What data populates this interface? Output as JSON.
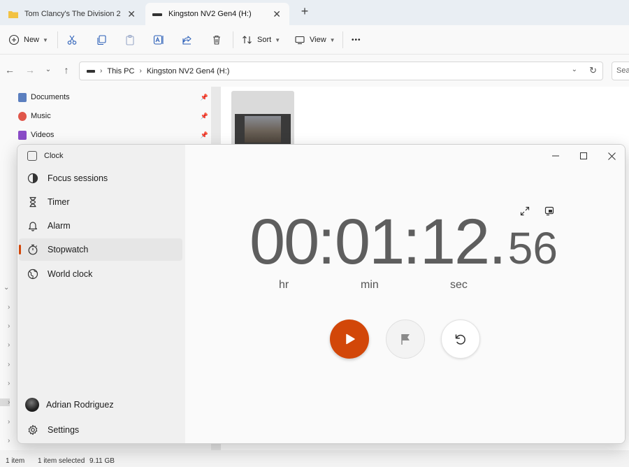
{
  "explorer": {
    "tabs": [
      {
        "label": "Tom Clancy's The Division 2",
        "close": "✕"
      },
      {
        "label": "Kingston NV2 Gen4 (H:)",
        "close": "✕"
      }
    ],
    "new_tab": "+",
    "toolbar": {
      "new_label": "New",
      "sort_label": "Sort",
      "view_label": "View",
      "more_label": "•••"
    },
    "address": {
      "crumbs": [
        "This PC",
        "Kingston NV2 Gen4 (H:)"
      ],
      "search_placeholder": "Sear"
    },
    "quick_access": [
      {
        "label": "Documents",
        "color": "#5b7fbf"
      },
      {
        "label": "Music",
        "color": "#e0564a"
      },
      {
        "label": "Videos",
        "color": "#8a4cc7"
      }
    ],
    "status": {
      "count": "1 item",
      "selected": "1 item selected",
      "size": "9.11 GB"
    }
  },
  "clock": {
    "app_title": "Clock",
    "nav": [
      {
        "label": "Focus sessions",
        "icon": "focus-icon"
      },
      {
        "label": "Timer",
        "icon": "hourglass-icon"
      },
      {
        "label": "Alarm",
        "icon": "bell-icon"
      },
      {
        "label": "Stopwatch",
        "icon": "stopwatch-icon",
        "selected": true
      },
      {
        "label": "World clock",
        "icon": "globe-icon"
      }
    ],
    "user_name": "Adrian Rodriguez",
    "settings_label": "Settings",
    "stopwatch": {
      "hours": "00",
      "minutes": "01",
      "seconds": "12",
      "hundredths": "56",
      "unit_hr": "hr",
      "unit_min": "min",
      "unit_sec": "sec"
    },
    "accent": "#d24709"
  }
}
